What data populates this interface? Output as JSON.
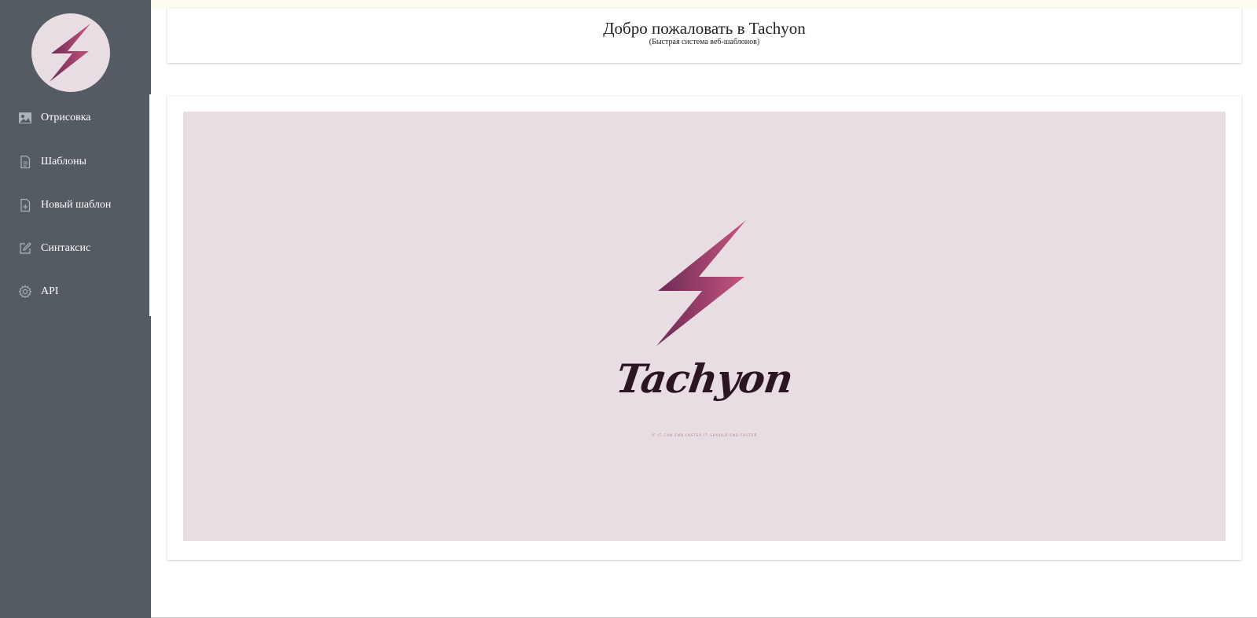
{
  "app": {
    "logo_icon": "lightning-bolt-icon"
  },
  "sidebar": {
    "items": [
      {
        "label": "Отрисовка",
        "icon": "image-icon"
      },
      {
        "label": "Шаблоны",
        "icon": "document-icon"
      },
      {
        "label": "Новый шаблон",
        "icon": "new-document-icon"
      },
      {
        "label": "Синтаксис",
        "icon": "edit-icon"
      },
      {
        "label": "API",
        "icon": "gear-icon"
      }
    ]
  },
  "header": {
    "title": "Добро пожаловать в Tachyon",
    "subtitle": "(Быстрая система веб-шаблонов)"
  },
  "preview": {
    "brand_name": "Tachyon",
    "tagline": "IF IT CAN END FASTER IT SHOULD END FASTER"
  },
  "colors": {
    "sidebar_bg": "#545b62",
    "panel_bg": "#e8dde3",
    "bolt_dark": "#6a2a55",
    "bolt_light": "#c8557e",
    "wordmark": "#2a1520"
  }
}
